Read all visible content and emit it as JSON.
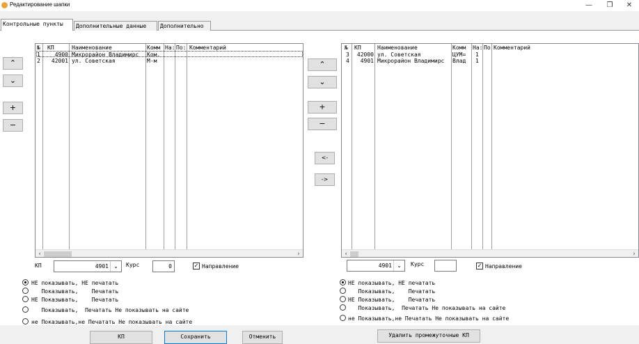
{
  "window": {
    "title": "Редактирование шапки"
  },
  "tabs": [
    "Контрольные пункты",
    "Дополнительные данные",
    "Дополнительно"
  ],
  "left_grid": {
    "columns": [
      "№",
      "КП",
      "Наименование",
      "Комм",
      "На:",
      "По:",
      "Комментарий"
    ],
    "rows": [
      [
        "1",
        "4900",
        "Микрорайон Владимирс",
        "Ком.",
        "",
        "",
        ""
      ],
      [
        "2",
        "42001",
        "ул. Советская",
        "М-м",
        "",
        "",
        ""
      ]
    ]
  },
  "right_grid": {
    "columns": [
      "№",
      "КП",
      "Наименование",
      "Комм",
      "На:",
      "По:",
      "Комментарий"
    ],
    "rows": [
      [
        "3",
        "42000",
        "ул. Советская",
        "ЦУМ=",
        "1",
        "",
        ""
      ],
      [
        "4",
        "4901",
        "Микрорайон Владимирс",
        "Влад",
        "1",
        "",
        ""
      ]
    ]
  },
  "left_controls": {
    "kp_label": "КП",
    "kp_value": "4901",
    "kurs_label": "Курс",
    "kurs_value": "0",
    "direction_label": "Направление",
    "direction_checked": true
  },
  "right_controls": {
    "kp_value": "4901",
    "kurs_label": "Курс",
    "kurs_value": "",
    "direction_label": "Направление",
    "direction_checked": true
  },
  "radio_options": [
    "НЕ показывать, НЕ печатать",
    "   Показывать,    Печатать",
    "НЕ Показывать,    Печатать",
    "   Показывать,  Печатать Не показывать на сайте",
    "не Показывать,не Печатать Не показывать на сайте"
  ],
  "left_radio_selected": 0,
  "right_radio_selected": 0,
  "buttons": {
    "up": "⌃",
    "down": "⌄",
    "plus": "+",
    "minus": "−",
    "move_left": "<-",
    "move_right": "->",
    "kp": "КП",
    "save": "Сохранить",
    "cancel": "Отменить",
    "delete_intermediate": "Удалить промежуточные КП"
  },
  "colors": {
    "accent_border": "#0078d7"
  }
}
